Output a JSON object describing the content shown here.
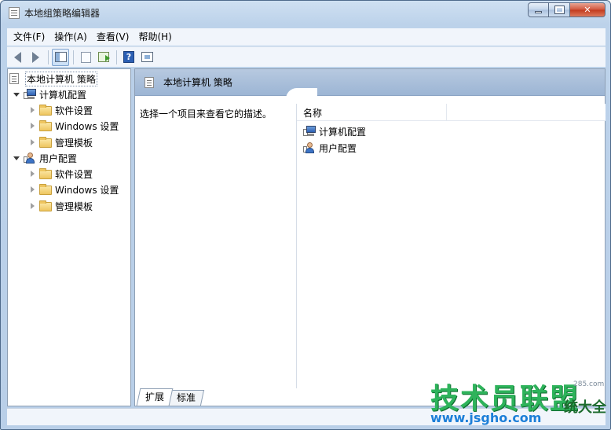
{
  "window": {
    "title": "本地组策略编辑器",
    "caption_close": "✕"
  },
  "menu": [
    {
      "label": "文件(F)"
    },
    {
      "label": "操作(A)"
    },
    {
      "label": "查看(V)"
    },
    {
      "label": "帮助(H)"
    }
  ],
  "toolbar": {
    "help_glyph": "?",
    "buttons": [
      "back-icon",
      "forward-icon",
      "show-hide-tree-icon",
      "properties-icon",
      "export-list-icon",
      "help-icon",
      "view-icon"
    ]
  },
  "tree": {
    "root": "本地计算机 策略",
    "items": [
      {
        "label": "计算机配置",
        "icon": "computer-icon",
        "expanded": true
      },
      {
        "label": "软件设置",
        "icon": "folder-icon"
      },
      {
        "label": "Windows 设置",
        "icon": "folder-icon"
      },
      {
        "label": "管理模板",
        "icon": "folder-icon"
      },
      {
        "label": "用户配置",
        "icon": "user-icon",
        "expanded": true
      },
      {
        "label": "软件设置",
        "icon": "folder-icon"
      },
      {
        "label": "Windows 设置",
        "icon": "folder-icon"
      },
      {
        "label": "管理模板",
        "icon": "folder-icon"
      }
    ]
  },
  "details": {
    "header_title": "本地计算机 策略",
    "description": "选择一个项目来查看它的描述。",
    "column_name": "名称",
    "rows": [
      {
        "label": "计算机配置",
        "icon": "computer-icon"
      },
      {
        "label": "用户配置",
        "icon": "user-icon"
      }
    ]
  },
  "tabs": [
    {
      "label": "扩展",
      "active": true
    },
    {
      "label": "标准",
      "active": false
    }
  ],
  "watermark": {
    "main": "技术员联盟",
    "url": "www.jsgho.com",
    "side": "统大全",
    "small": "285.com"
  }
}
